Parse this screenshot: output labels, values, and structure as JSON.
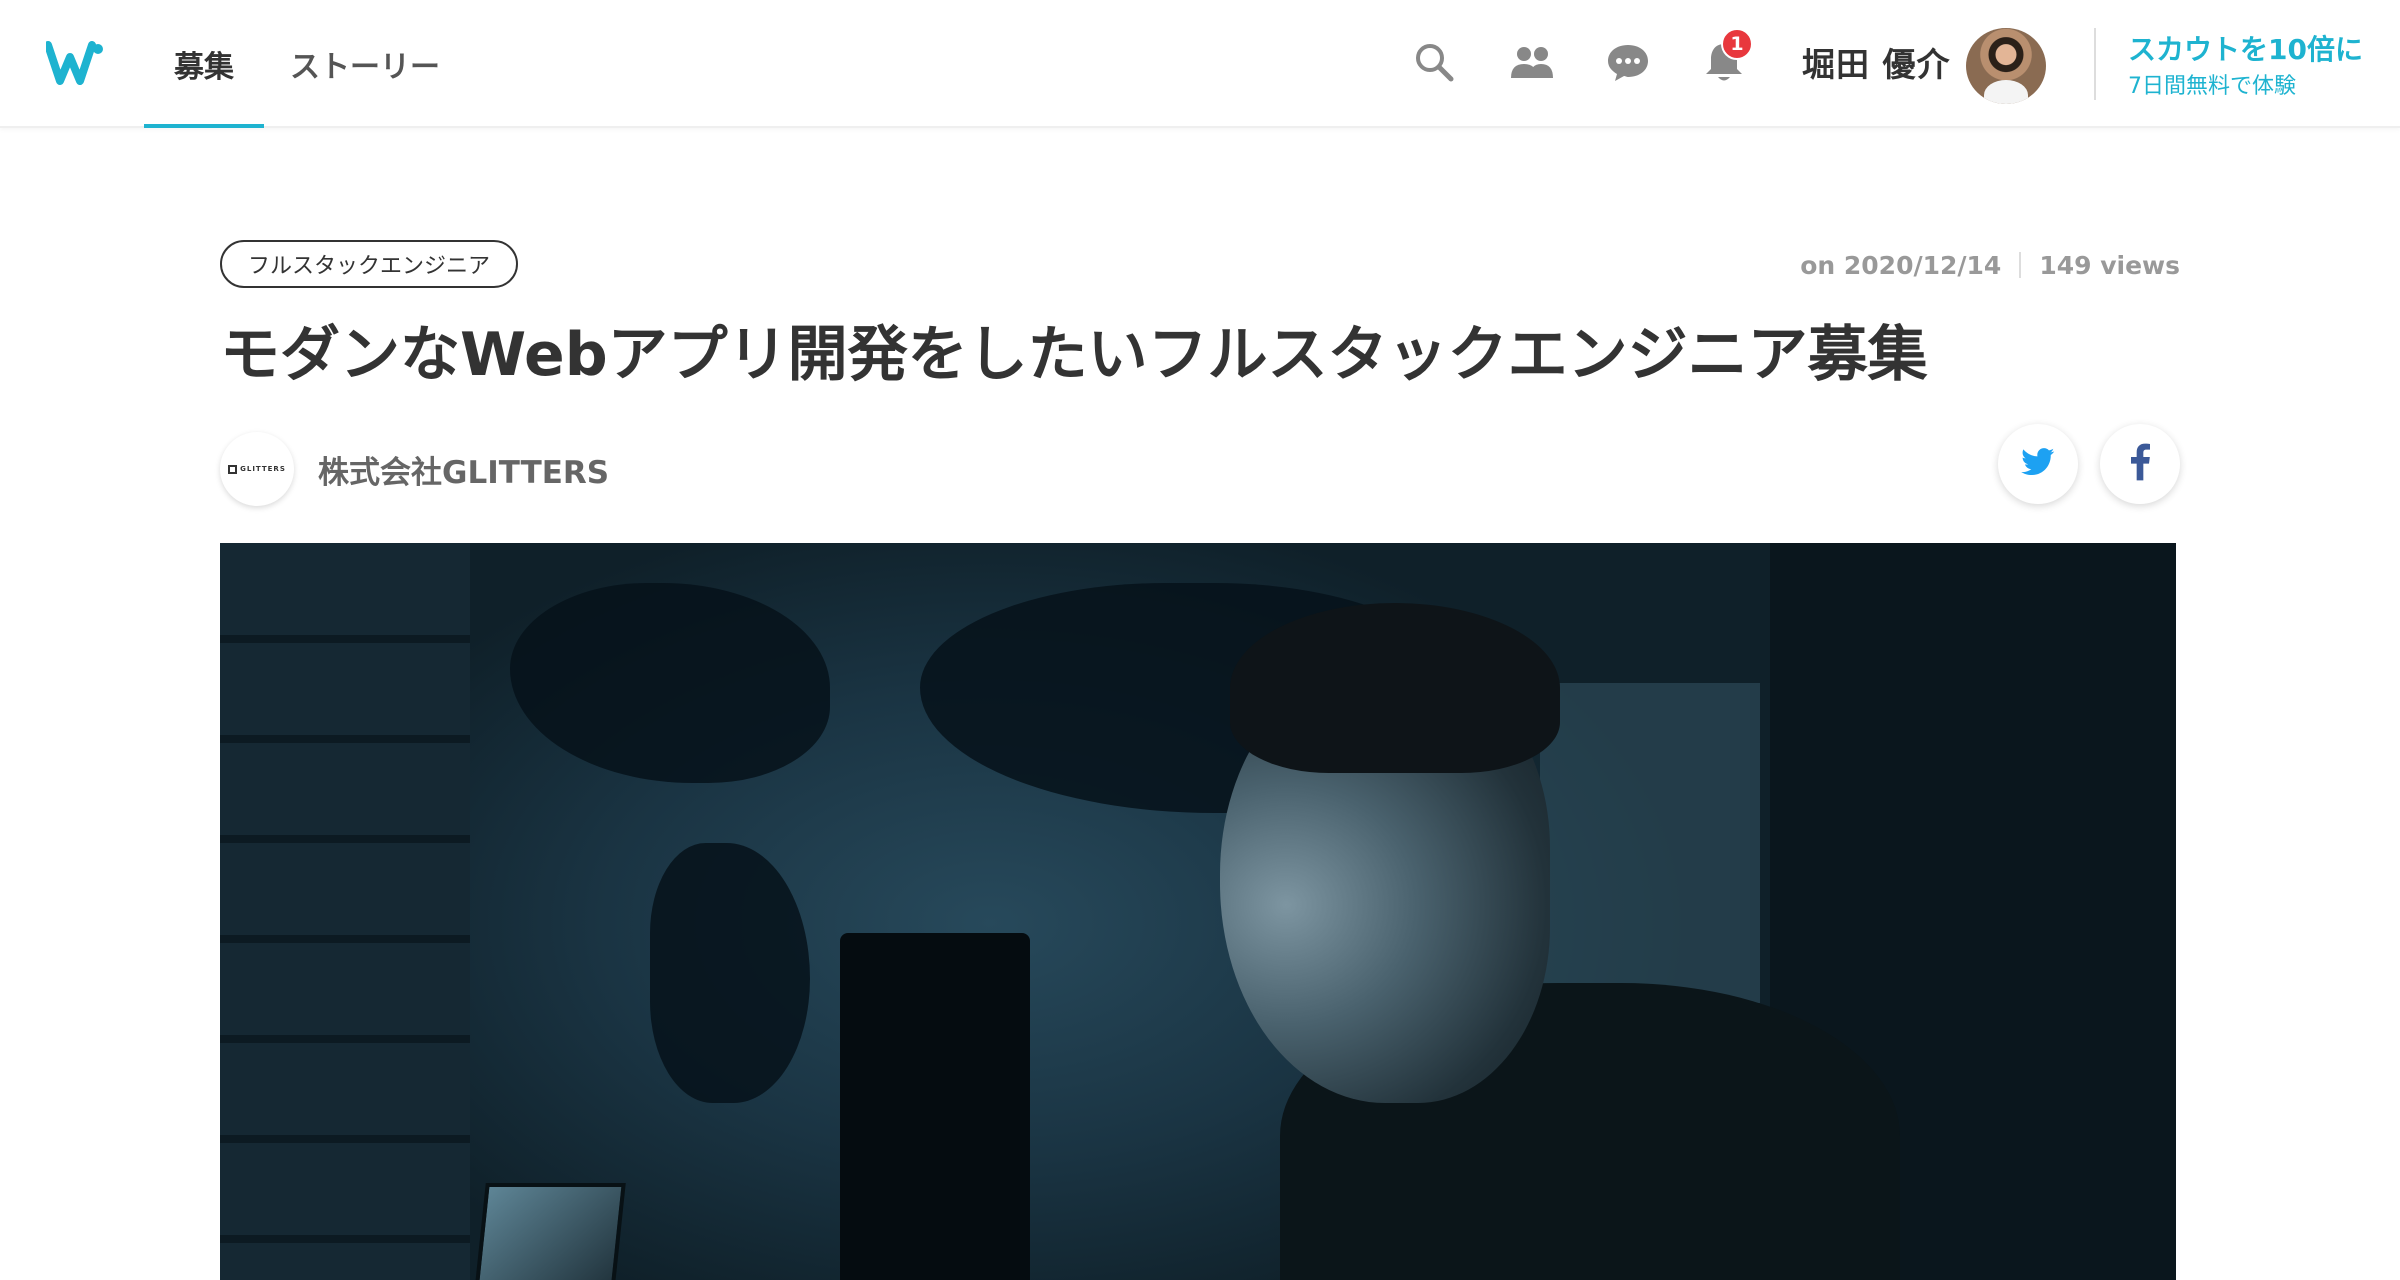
{
  "header": {
    "logo_icon": "wantedly-w-logo",
    "tabs": [
      {
        "label": "募集",
        "active": true
      },
      {
        "label": "ストーリー",
        "active": false
      }
    ],
    "icons": [
      "search-icon",
      "people-icon",
      "chat-icon",
      "bell-icon"
    ],
    "notification_count": "1",
    "user_name": "堀田 優介",
    "scout_main": "スカウトを10倍に",
    "scout_sub": "7日間無料で体験",
    "accent_color": "#1eb3d0",
    "badge_color": "#e8383d"
  },
  "article": {
    "tag": "フルスタックエンジニア",
    "date": "on 2020/12/14",
    "views": "149 views",
    "title": "モダンなWebアプリ開発をしたいフルスタックエンジニア募集",
    "company_logo_text": "GLITTERS",
    "company_name": "株式会社GLITTERS",
    "share_icons": [
      "twitter-icon",
      "facebook-icon"
    ],
    "twitter_color": "#1da1f2",
    "facebook_color": "#3b5998"
  }
}
